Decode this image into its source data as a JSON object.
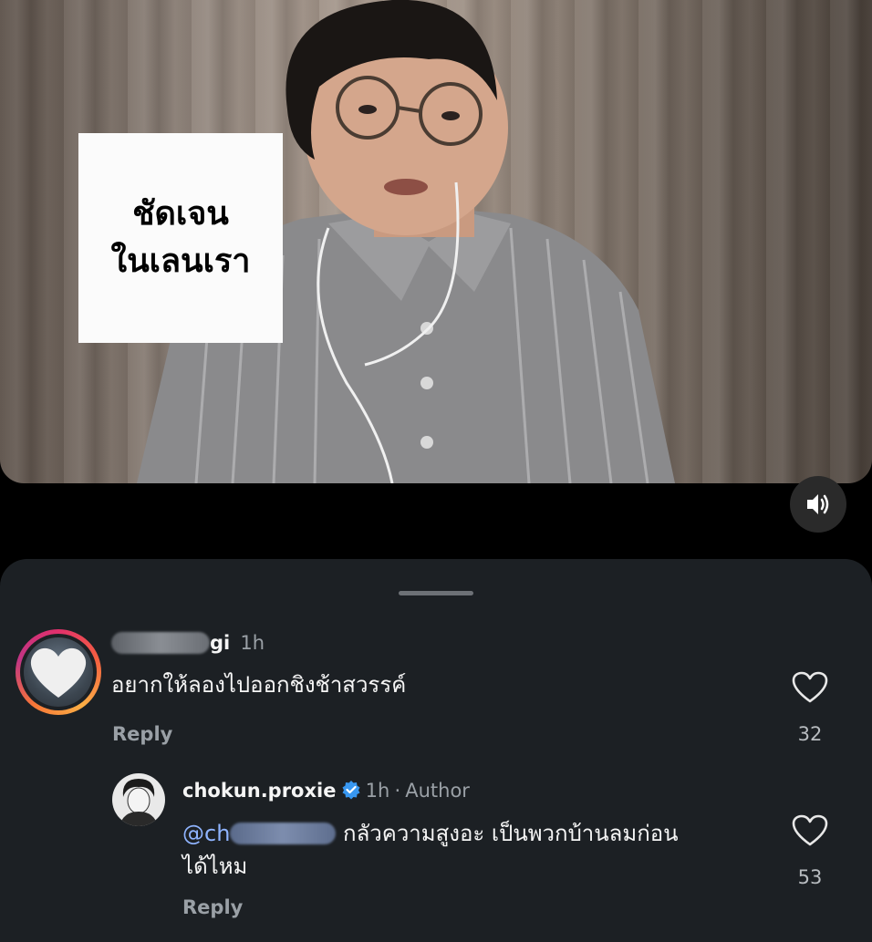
{
  "video": {
    "overlay_line1": "ชัดเจน",
    "overlay_line2": "ในเลนเรา",
    "mute_icon": "speaker-icon"
  },
  "comments": [
    {
      "username_suffix": "gi",
      "time": "1h",
      "text": "อยากให้ลองไปออกชิงช้าสวรรค์",
      "reply_label": "Reply",
      "likes": "32"
    }
  ],
  "reply": {
    "username": "chokun.proxie",
    "time": "1h",
    "separator": "·",
    "badge": "Author",
    "mention_prefix": "@ch",
    "text_line1": "กลัวความสูงอะ เป็นพวกบ้านลมก่อน",
    "text_line2": "ได้ไหม",
    "reply_label": "Reply",
    "likes": "53"
  }
}
